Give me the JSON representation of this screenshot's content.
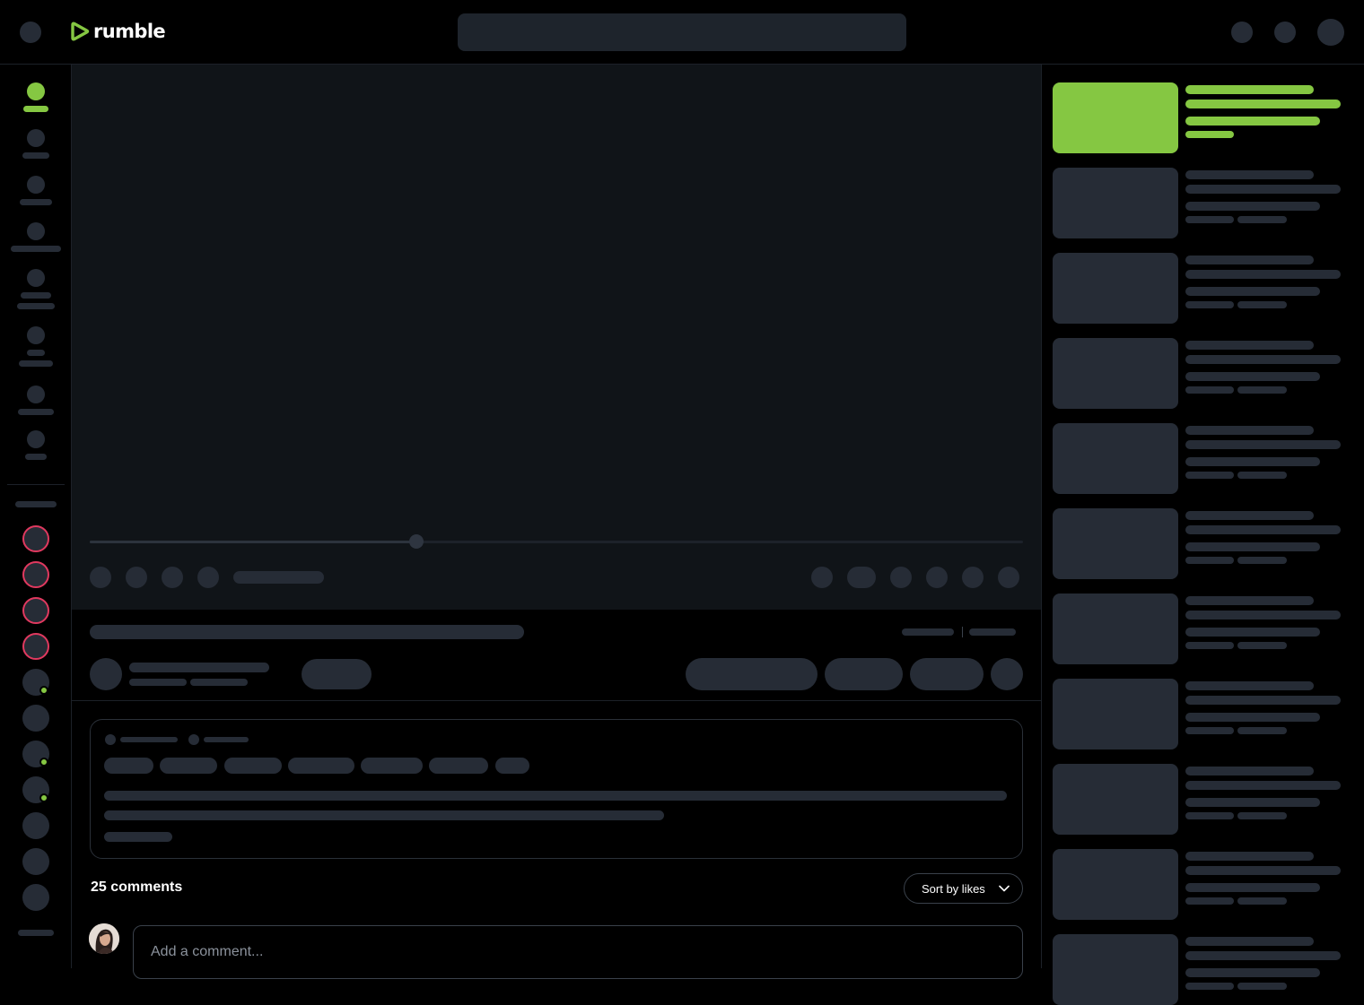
{
  "header": {
    "brand": "rumble",
    "brand_color": "#85c742",
    "icons": [
      "menu-icon",
      "search-icon",
      "upload-icon",
      "notifications-icon",
      "account-avatar"
    ]
  },
  "sidebar": {
    "active_color": "#85c742",
    "live_indicator_color": "#85c742",
    "subscription_ring_color": "#e0395f"
  },
  "player": {
    "progress": 0.35
  },
  "comments": {
    "count_label": "25 comments",
    "sort_label": "Sort by likes",
    "input_placeholder": "Add a comment..."
  },
  "related": {
    "active_index": 0,
    "highlight_color": "#85c742"
  }
}
